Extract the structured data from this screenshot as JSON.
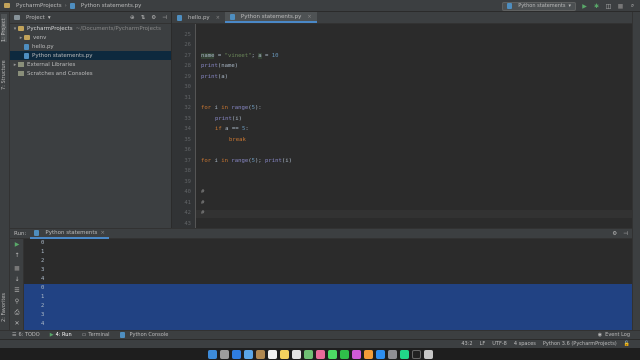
{
  "topbar": {
    "project": "PycharmProjects",
    "file": "Python statements.py",
    "run_config": "Python statements"
  },
  "leftstrip": {
    "project_label": "1: Project",
    "structure_label": "7: Structure",
    "favorites_label": "2: Favorites"
  },
  "project_pane": {
    "title": "Project",
    "root": "PycharmProjects",
    "root_path": "~/Documents/PycharmProjects",
    "items": [
      {
        "label": "venv",
        "type": "folder"
      },
      {
        "label": "hello.py",
        "type": "file"
      },
      {
        "label": "Python statements.py",
        "type": "file"
      },
      {
        "label": "External Libraries",
        "type": "lib"
      },
      {
        "label": "Scratches and Consoles",
        "type": "lib"
      }
    ]
  },
  "editor": {
    "tabs": [
      {
        "label": "hello.py",
        "active": false
      },
      {
        "label": "Python statements.py",
        "active": true
      }
    ],
    "line_numbers": [
      "25",
      "26",
      "27",
      "28",
      "29",
      "30",
      "31",
      "32",
      "33",
      "34",
      "35",
      "36",
      "37",
      "38",
      "39",
      "40",
      "41",
      "42",
      "43"
    ],
    "code": {
      "l27_a": "name",
      "l27_b": " = ",
      "l27_c": "\"vineet\"",
      "l27_d": "; ",
      "l27_e": "a",
      "l27_f": " = ",
      "l27_g": "10",
      "l28_a": "print",
      "l28_b": "(name)",
      "l29_a": "print",
      "l29_b": "(a)",
      "l32_a": "for",
      "l32_b": " i ",
      "l32_c": "in",
      "l32_d": " ",
      "l32_e": "range",
      "l32_f": "(",
      "l32_g": "5",
      "l32_h": "):",
      "l33_a": "print",
      "l33_b": "(i)",
      "l34_a": "if",
      "l34_b": " a == ",
      "l34_c": "5",
      "l34_d": ":",
      "l35_a": "break",
      "l37_a": "for",
      "l37_b": " i ",
      "l37_c": "in",
      "l37_d": " ",
      "l37_e": "range",
      "l37_f": "(",
      "l37_g": "5",
      "l37_h": "); ",
      "l37_i": "print",
      "l37_j": "(i)",
      "l41": "#",
      "l42": "#",
      "l43": "#"
    }
  },
  "run_panel": {
    "label": "Run:",
    "tab": "Python statements",
    "output": [
      "0",
      "1",
      "2",
      "3",
      "4",
      "0",
      "1",
      "2",
      "3",
      "4"
    ]
  },
  "bottombar": {
    "todo": "6: TODO",
    "run": "4: Run",
    "terminal": "Terminal",
    "python_console": "Python Console",
    "event_log": "Event Log"
  },
  "statusbar": {
    "position": "43:2",
    "line_sep": "LF",
    "encoding": "UTF-8",
    "indent": "4 spaces",
    "interpreter": "Python 3.6 (PycharmProjects)"
  },
  "colors": {
    "selection": "#214283",
    "accent": "#4a88c7",
    "keyword": "#cc7832",
    "string": "#6a8759",
    "number": "#6897bb"
  },
  "dock": [
    "finder",
    "launchpad",
    "safari",
    "mail",
    "contacts",
    "calendar",
    "notes",
    "reminders",
    "maps",
    "photos",
    "messages",
    "facetime",
    "itunes",
    "books",
    "app-store",
    "preferences",
    "pycharm",
    "terminal",
    "trash"
  ]
}
